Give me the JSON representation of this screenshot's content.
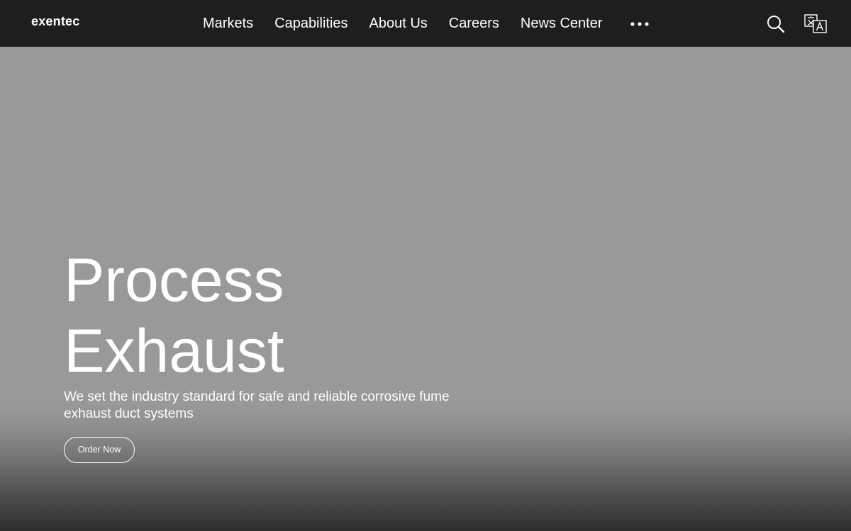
{
  "header": {
    "logo_text": "exentec",
    "nav": [
      {
        "label": "Markets"
      },
      {
        "label": "Capabilities"
      },
      {
        "label": "About Us"
      },
      {
        "label": "Careers"
      },
      {
        "label": "News Center"
      }
    ],
    "more_icon": "more-horizontal-icon",
    "search_icon": "search-icon",
    "language_icon": "translate-icon"
  },
  "hero": {
    "title_line1": "Process",
    "title_line2": "Exhaust",
    "subtitle_line1": "We set the industry standard for safe and reliable corrosive fume",
    "subtitle_line2": "exhaust duct systems",
    "cta_label": "Order Now"
  },
  "colors": {
    "header_bg": "#1e1e1e",
    "hero_bg": "#999999",
    "text": "#ffffff"
  }
}
